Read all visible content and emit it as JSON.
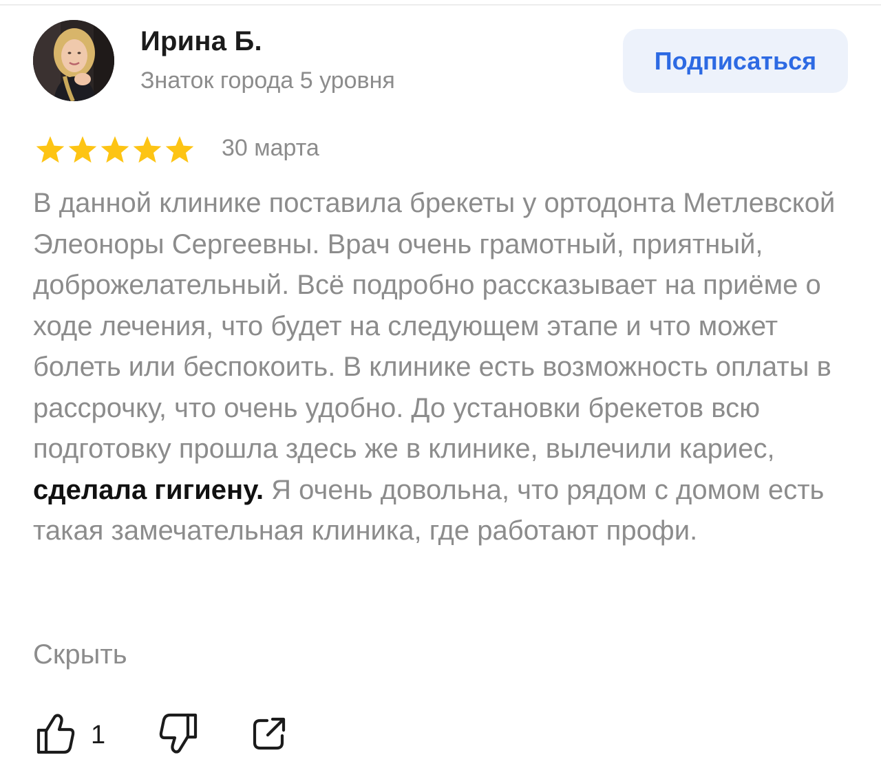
{
  "author": {
    "name": "Ирина Б.",
    "level": "Знаток города 5 уровня"
  },
  "subscribe": {
    "label": "Подписаться"
  },
  "review": {
    "rating": 5,
    "rating_max": 5,
    "date": "30 марта",
    "text_before": "В данной клинике поставила брекеты у ортодонта Метлевской Элеоноры Сергеевны. Врач очень грамотный, приятный, доброжелательный. Всё подробно рассказывает на приёме о ходе лечения, что будет на следующем этапе и что может болеть или беспокоить. В клинике есть возможность оплаты в рассрочку, что очень удобно. До установки брекетов всю подготовку прошла здесь же в клинике, вылечили кариес, ",
    "text_highlight": "сделала гигиену.",
    "text_after": " Я очень довольна, что рядом с домом есть такая замечательная клиника, где работают профи.",
    "collapse_label": "Скрыть"
  },
  "actions": {
    "like_count": "1",
    "like_icon": "thumbs-up-icon",
    "dislike_icon": "thumbs-down-icon",
    "share_icon": "share-icon"
  },
  "colors": {
    "star": "#fdc414",
    "accent": "#2d6ae3",
    "button_bg": "#edf2fb",
    "muted_text": "#8c8c8c"
  }
}
